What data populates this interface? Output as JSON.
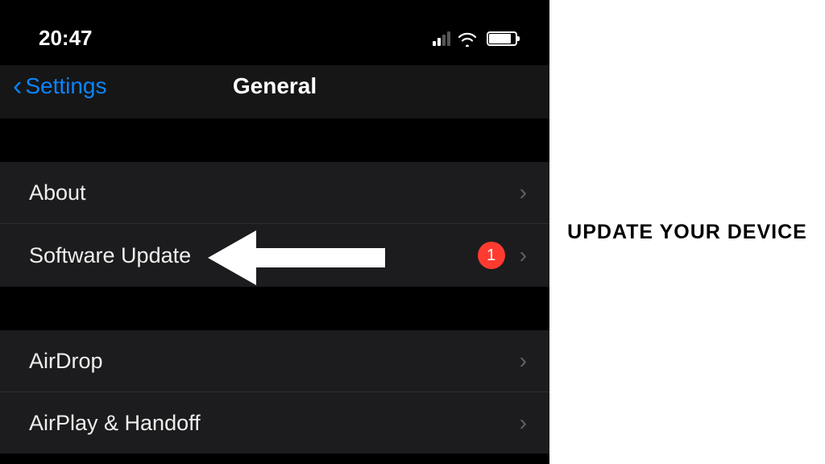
{
  "status": {
    "time": "20:47"
  },
  "nav": {
    "back_label": "Settings",
    "title": "General"
  },
  "sections": [
    {
      "rows": [
        {
          "label": "About",
          "badge": null
        },
        {
          "label": "Software Update",
          "badge": "1"
        }
      ]
    },
    {
      "rows": [
        {
          "label": "AirDrop",
          "badge": null
        },
        {
          "label": "AirPlay & Handoff",
          "badge": null
        }
      ]
    }
  ],
  "caption": "UPDATE YOUR DEVICE"
}
